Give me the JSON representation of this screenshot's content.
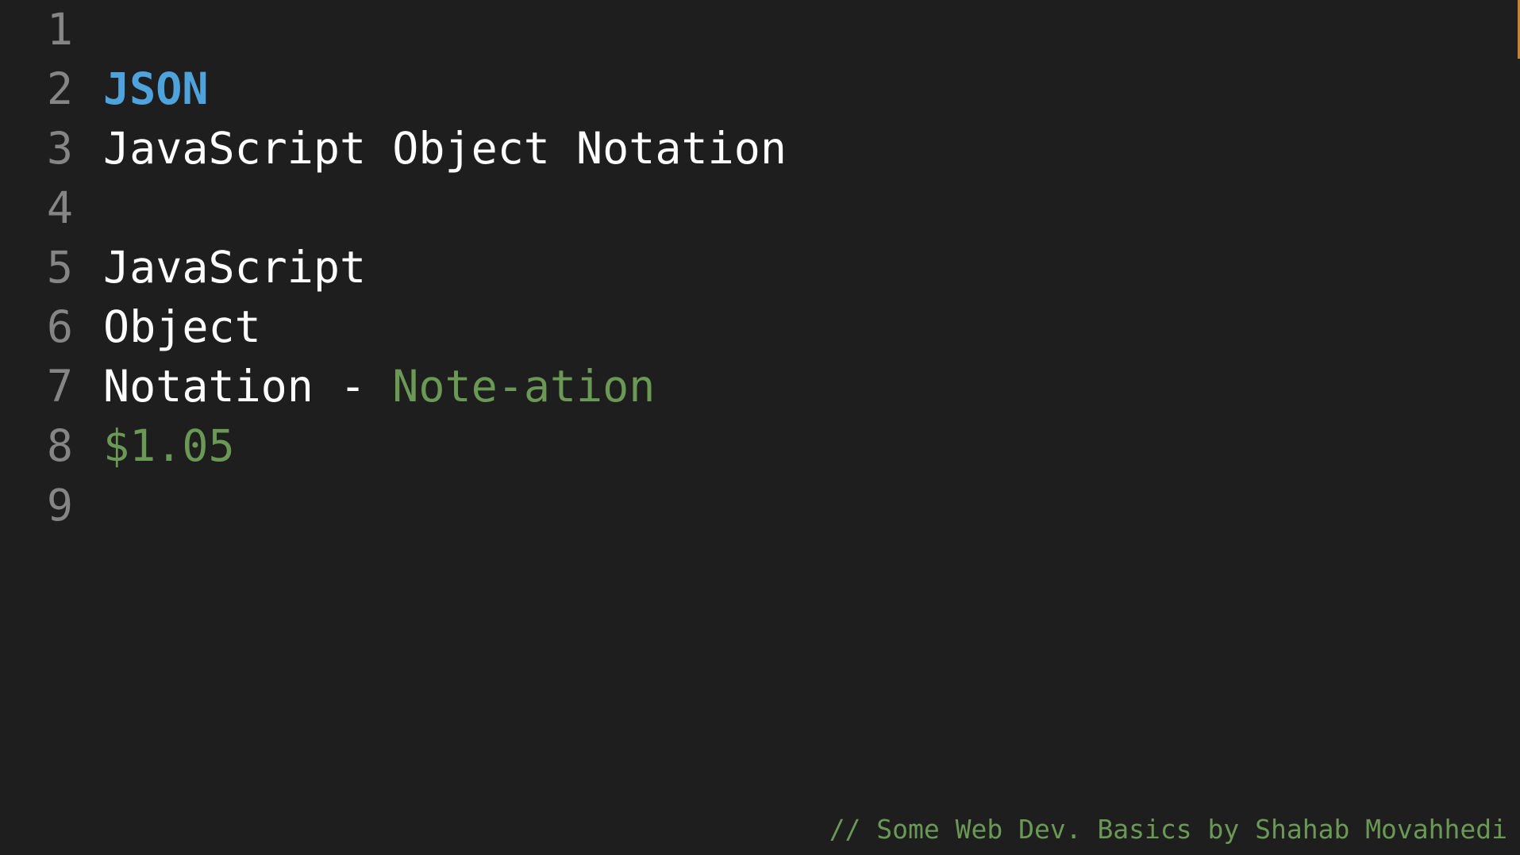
{
  "editor": {
    "lines": [
      {
        "number": "1",
        "segments": []
      },
      {
        "number": "2",
        "segments": [
          {
            "text": "JSON",
            "style": "keyword"
          }
        ]
      },
      {
        "number": "3",
        "segments": [
          {
            "text": "JavaScript Object Notation",
            "style": "plain"
          }
        ]
      },
      {
        "number": "4",
        "segments": []
      },
      {
        "number": "5",
        "segments": [
          {
            "text": "JavaScript",
            "style": "plain"
          }
        ]
      },
      {
        "number": "6",
        "segments": [
          {
            "text": "Object",
            "style": "plain"
          }
        ]
      },
      {
        "number": "7",
        "segments": [
          {
            "text": "Notation - ",
            "style": "plain"
          },
          {
            "text": "Note-ation",
            "style": "green"
          }
        ]
      },
      {
        "number": "8",
        "segments": [
          {
            "text": "$1.05",
            "style": "green"
          }
        ]
      },
      {
        "number": "9",
        "segments": []
      }
    ]
  },
  "footer": {
    "comment": "// Some Web Dev. Basics by Shahab Movahhedi"
  },
  "colors": {
    "background": "#1e1e1e",
    "line_number": "#858585",
    "keyword": "#4fa3dc",
    "plain": "#ffffff",
    "green": "#6a9955",
    "scroll_marker": "#c9832f"
  }
}
